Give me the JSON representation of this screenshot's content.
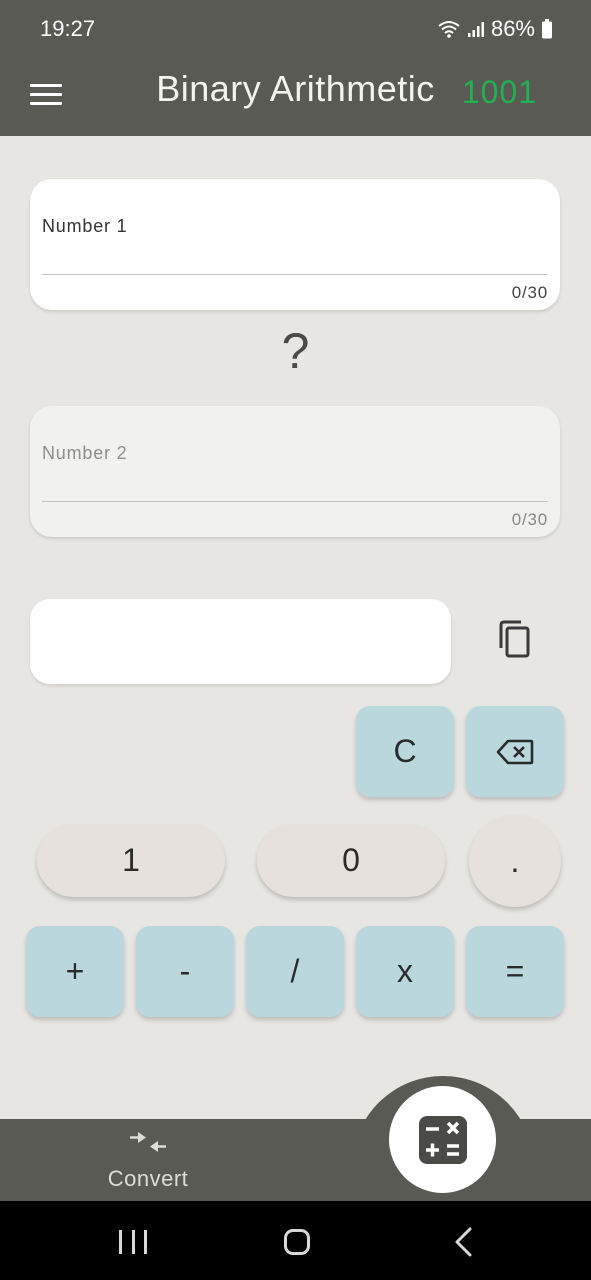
{
  "status_bar": {
    "time": "19:27",
    "battery": "86%"
  },
  "app_bar": {
    "title": "Binary Arithmetic",
    "badge": "1001"
  },
  "number1": {
    "label": "Number 1",
    "counter": "0/30"
  },
  "operator_display": "?",
  "number2": {
    "label": "Number 2",
    "counter": "0/30"
  },
  "keypad": {
    "clear": "C",
    "one": "1",
    "zero": "0",
    "dot": ".",
    "plus": "+",
    "minus": "-",
    "divide": "/",
    "multiply": "x",
    "equals": "="
  },
  "bottom_nav": {
    "convert_label": "Convert"
  },
  "icons": {
    "menu": "menu-icon",
    "copy": "copy-icon",
    "backspace": "backspace-icon",
    "convert": "convert-icon",
    "calculator": "calculator-icon"
  },
  "colors": {
    "app_bar": "#5a5a54",
    "badge_green": "#22b052",
    "operator_key": "#bad7de",
    "digit_key": "#e6e1dd",
    "background": "#e8e6e2"
  }
}
